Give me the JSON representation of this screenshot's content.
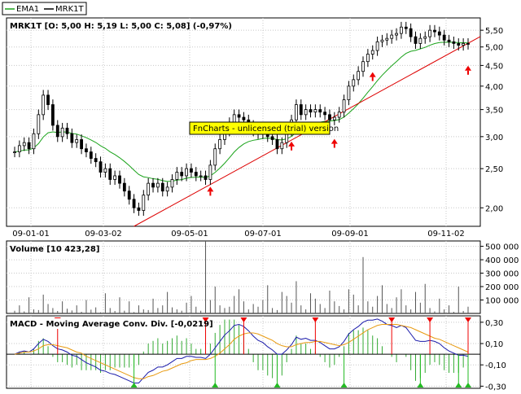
{
  "chart_data": [
    {
      "type": "candlestick",
      "title": "MRK1T [O: 5,00  H: 5,19  L: 5,00  C: 5,08] (-0,97%)",
      "legend": [
        {
          "name": "EMA1",
          "color": "#1aa31a"
        },
        {
          "name": "MRK1T",
          "color": "#000000"
        }
      ],
      "legend_position": "top-left",
      "y_scale": "log",
      "ylim": [
        1.8,
        5.9
      ],
      "y_ticks": [
        "2,00",
        "2,50",
        "3,00",
        "3,50",
        "4,00",
        "4,50",
        "5,00",
        "5,50"
      ],
      "x_ticks": [
        "09-01-01",
        "09-03-02",
        "09-05-01",
        "09-07-01",
        "09-09-01",
        "09-11-02"
      ],
      "grid": true,
      "watermark": "FnCharts - unlicensed (trial) version",
      "price_close": [
        2.75,
        2.85,
        2.9,
        2.8,
        3.05,
        3.4,
        3.8,
        3.6,
        3.2,
        3.0,
        3.15,
        3.05,
        2.9,
        2.95,
        2.8,
        2.75,
        2.65,
        2.6,
        2.45,
        2.5,
        2.35,
        2.4,
        2.3,
        2.2,
        2.1,
        2.0,
        1.97,
        2.15,
        2.3,
        2.25,
        2.3,
        2.2,
        2.25,
        2.35,
        2.45,
        2.4,
        2.5,
        2.45,
        2.4,
        2.4,
        2.35,
        2.55,
        2.8,
        2.95,
        3.1,
        3.25,
        3.4,
        3.35,
        3.3,
        3.2,
        3.1,
        3.05,
        3.1,
        3.0,
        2.95,
        2.8,
        2.9,
        3.1,
        3.3,
        3.6,
        3.4,
        3.5,
        3.45,
        3.5,
        3.45,
        3.4,
        3.3,
        3.35,
        3.45,
        3.7,
        4.0,
        4.15,
        4.35,
        4.6,
        4.8,
        4.9,
        5.15,
        5.2,
        5.25,
        5.35,
        5.4,
        5.6,
        5.55,
        5.3,
        5.1,
        5.25,
        5.3,
        5.5,
        5.45,
        5.35,
        5.2,
        5.15,
        5.1,
        5.05,
        5.1,
        5.08
      ],
      "ema_color": "#1aa31a",
      "trendline_color": "#dd0000",
      "trendline": {
        "from_index": 25,
        "from_price": 1.8,
        "to_index": 95,
        "to_price": 5.2
      },
      "signal_arrows_idx": [
        41,
        58,
        67,
        75,
        95
      ],
      "arrow_color": "#ee0000"
    },
    {
      "type": "bar",
      "title": "Volume [10 423,28]",
      "ylim": [
        0,
        540000
      ],
      "y_ticks": [
        "100 000",
        "200 000",
        "300 000",
        "400 000",
        "500 000"
      ],
      "grid": true,
      "bar_color": "#555555",
      "values": [
        20000,
        60000,
        15000,
        120000,
        30000,
        25000,
        140000,
        70000,
        40000,
        18000,
        90000,
        35000,
        22000,
        60000,
        12000,
        100000,
        28000,
        45000,
        8000,
        150000,
        40000,
        18000,
        120000,
        20000,
        90000,
        10000,
        60000,
        30000,
        25000,
        110000,
        40000,
        60000,
        160000,
        45000,
        30000,
        20000,
        80000,
        130000,
        50000,
        20000,
        540000,
        100000,
        200000,
        60000,
        40000,
        50000,
        130000,
        180000,
        90000,
        30000,
        70000,
        50000,
        100000,
        210000,
        40000,
        25000,
        160000,
        130000,
        80000,
        240000,
        60000,
        30000,
        150000,
        110000,
        70000,
        40000,
        170000,
        90000,
        55000,
        30000,
        180000,
        140000,
        60000,
        420000,
        90000,
        50000,
        130000,
        210000,
        70000,
        40000,
        120000,
        180000,
        60000,
        30000,
        160000,
        80000,
        220000,
        40000,
        15000,
        110000,
        30000,
        60000,
        12000,
        200000,
        18000,
        50000
      ]
    },
    {
      "type": "line",
      "title": "MACD - Moving Average Conv. Div. [-0,0219]",
      "ylim": [
        -0.32,
        0.36
      ],
      "y_ticks": [
        "0,30",
        "0,10",
        "-0,10",
        "-0,30"
      ],
      "grid": true,
      "series": [
        {
          "color": "#1a1aaa",
          "values": [
            0.0,
            0.02,
            0.03,
            0.02,
            0.05,
            0.1,
            0.14,
            0.12,
            0.08,
            0.05,
            0.04,
            0.02,
            -0.01,
            -0.02,
            -0.05,
            -0.08,
            -0.1,
            -0.12,
            -0.15,
            -0.16,
            -0.18,
            -0.19,
            -0.21,
            -0.23,
            -0.25,
            -0.27,
            -0.27,
            -0.22,
            -0.17,
            -0.15,
            -0.12,
            -0.12,
            -0.1,
            -0.07,
            -0.04,
            -0.04,
            -0.02,
            -0.02,
            -0.03,
            -0.03,
            -0.04,
            0.0,
            0.06,
            0.12,
            0.18,
            0.22,
            0.27,
            0.28,
            0.26,
            0.22,
            0.17,
            0.13,
            0.11,
            0.07,
            0.04,
            0.0,
            0.0,
            0.04,
            0.09,
            0.16,
            0.14,
            0.15,
            0.13,
            0.13,
            0.11,
            0.08,
            0.05,
            0.05,
            0.07,
            0.12,
            0.19,
            0.23,
            0.26,
            0.3,
            0.32,
            0.32,
            0.33,
            0.31,
            0.28,
            0.27,
            0.25,
            0.27,
            0.25,
            0.19,
            0.13,
            0.12,
            0.12,
            0.13,
            0.12,
            0.1,
            0.06,
            0.03,
            0.01,
            -0.01,
            -0.01,
            -0.02
          ]
        },
        {
          "color": "#e89a10",
          "values": [
            0.0,
            0.01,
            0.02,
            0.02,
            0.03,
            0.05,
            0.08,
            0.09,
            0.09,
            0.08,
            0.07,
            0.06,
            0.04,
            0.02,
            0.01,
            -0.02,
            -0.04,
            -0.06,
            -0.08,
            -0.1,
            -0.12,
            -0.14,
            -0.16,
            -0.18,
            -0.2,
            -0.22,
            -0.23,
            -0.23,
            -0.21,
            -0.2,
            -0.18,
            -0.16,
            -0.15,
            -0.13,
            -0.11,
            -0.09,
            -0.08,
            -0.06,
            -0.05,
            -0.05,
            -0.05,
            -0.04,
            -0.02,
            0.01,
            0.05,
            0.09,
            0.14,
            0.17,
            0.19,
            0.2,
            0.2,
            0.19,
            0.17,
            0.15,
            0.13,
            0.1,
            0.08,
            0.07,
            0.07,
            0.09,
            0.1,
            0.11,
            0.11,
            0.12,
            0.12,
            0.11,
            0.1,
            0.09,
            0.08,
            0.09,
            0.11,
            0.14,
            0.17,
            0.2,
            0.23,
            0.25,
            0.27,
            0.28,
            0.28,
            0.28,
            0.28,
            0.27,
            0.26,
            0.25,
            0.23,
            0.21,
            0.19,
            0.17,
            0.15,
            0.14,
            0.12,
            0.1,
            0.08,
            0.06,
            0.04,
            0.02
          ]
        }
      ],
      "histogram_color": "#33aa33",
      "sell_arrows_idx": [
        9,
        40,
        48,
        63,
        79,
        87,
        97
      ],
      "buy_arrows_idx": [
        25,
        42,
        55,
        69,
        85,
        93,
        95
      ],
      "sell_color": "#ee0000",
      "buy_color": "#22bb22"
    }
  ]
}
